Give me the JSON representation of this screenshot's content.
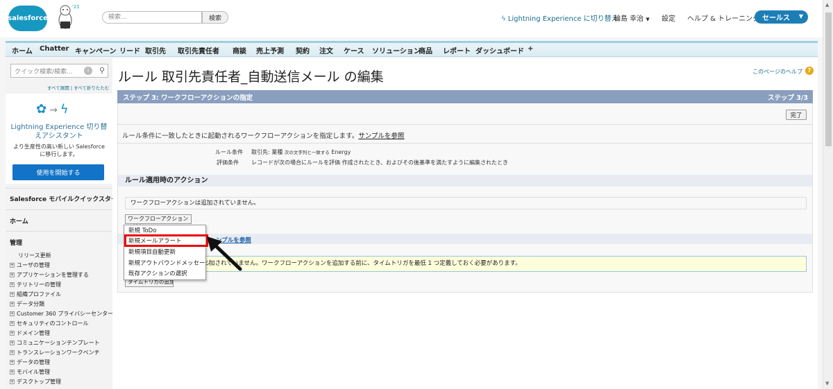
{
  "header": {
    "logo_text": "salesforce",
    "search_placeholder": "検索...",
    "search_button": "検索",
    "lightning_switch": "Lightning Experience に切り替え",
    "user_name": "輪島 幸治",
    "setup": "設定",
    "help_training": "ヘルプ & トレーニング",
    "app_name": "セールス"
  },
  "tabs": [
    "ホーム",
    "Chatter",
    "キャンペーン",
    "リード",
    "取引先",
    "取引先責任者",
    "商談",
    "売上予測",
    "契約",
    "注文",
    "ケース",
    "ソリューション",
    "商品",
    "レポート",
    "ダッシュボード",
    "+"
  ],
  "sidebar": {
    "quick_search_placeholder": "クイック検索/検索...",
    "expand_all": "すべて展開",
    "collapse_all": "すべて折りたたむ",
    "le_title": "Lightning Experience 切り替えアシスタント",
    "le_desc": "より生産性の高い新しい Salesforce に移行します。",
    "le_button": "使用を開始する",
    "mobile_quickstart": "Salesforce モバイルクイックスタート",
    "home": "ホーム",
    "admin": "管理",
    "release_update": "リリース更新",
    "items": [
      "ユーザの管理",
      "アプリケーションを管理する",
      "テリトリーの管理",
      "組織プロファイル",
      "データ分類",
      "Customer 360 プライバシーセンター",
      "セキュリティのコントロール",
      "ドメイン管理",
      "コミュニケーションテンプレート",
      "トランスレーションワークベンチ",
      "データの管理",
      "モバイル管理",
      "デスクトップ管理"
    ]
  },
  "main": {
    "title": "ルール 取引先責任者_自動送信メール の編集",
    "help_link": "このページのヘルプ",
    "step_title": "ステップ 3: ワークフローアクションの指定",
    "step_count": "ステップ 3/3",
    "done_button": "完了",
    "instruction": "ルール条件に一致したときに起動されるワークフローアクションを指定します。",
    "sample_link": "サンプルを参照",
    "rule_condition_label": "ルール条件",
    "rule_condition_value": "取引先: 業種",
    "rule_condition_op": "次の文字列と一致する",
    "rule_condition_target": "Energy",
    "eval_label": "評価条件",
    "eval_value": "レコードが次の場合にルールを評価 作成されたとき、およびその後基準を満たすように編集されたとき",
    "section_immediate": "ルール適用時のアクション",
    "no_actions": "ワークフローアクションは追加されていません。",
    "add_action_button": "ワークフローアクションの追加 ▼",
    "timed_link": "ンプルを参照",
    "warn_text": "加されていません。ワークフローアクションを追加する前に、タイムトリガを最低 1 つ定義しておく必要があります。",
    "timed_trigger_button": "タイムトリガの追加"
  },
  "dropdown": {
    "items": [
      "新規 ToDo",
      "新規メールアラート",
      "新規項目自動更新",
      "新規アウトバウンドメッセージ",
      "既存アクションの選択"
    ]
  },
  "colors": {
    "brand": "#1798c1",
    "step_bar": "#8a9ebe",
    "highlight": "#e00000",
    "button_blue": "#1273c7"
  }
}
